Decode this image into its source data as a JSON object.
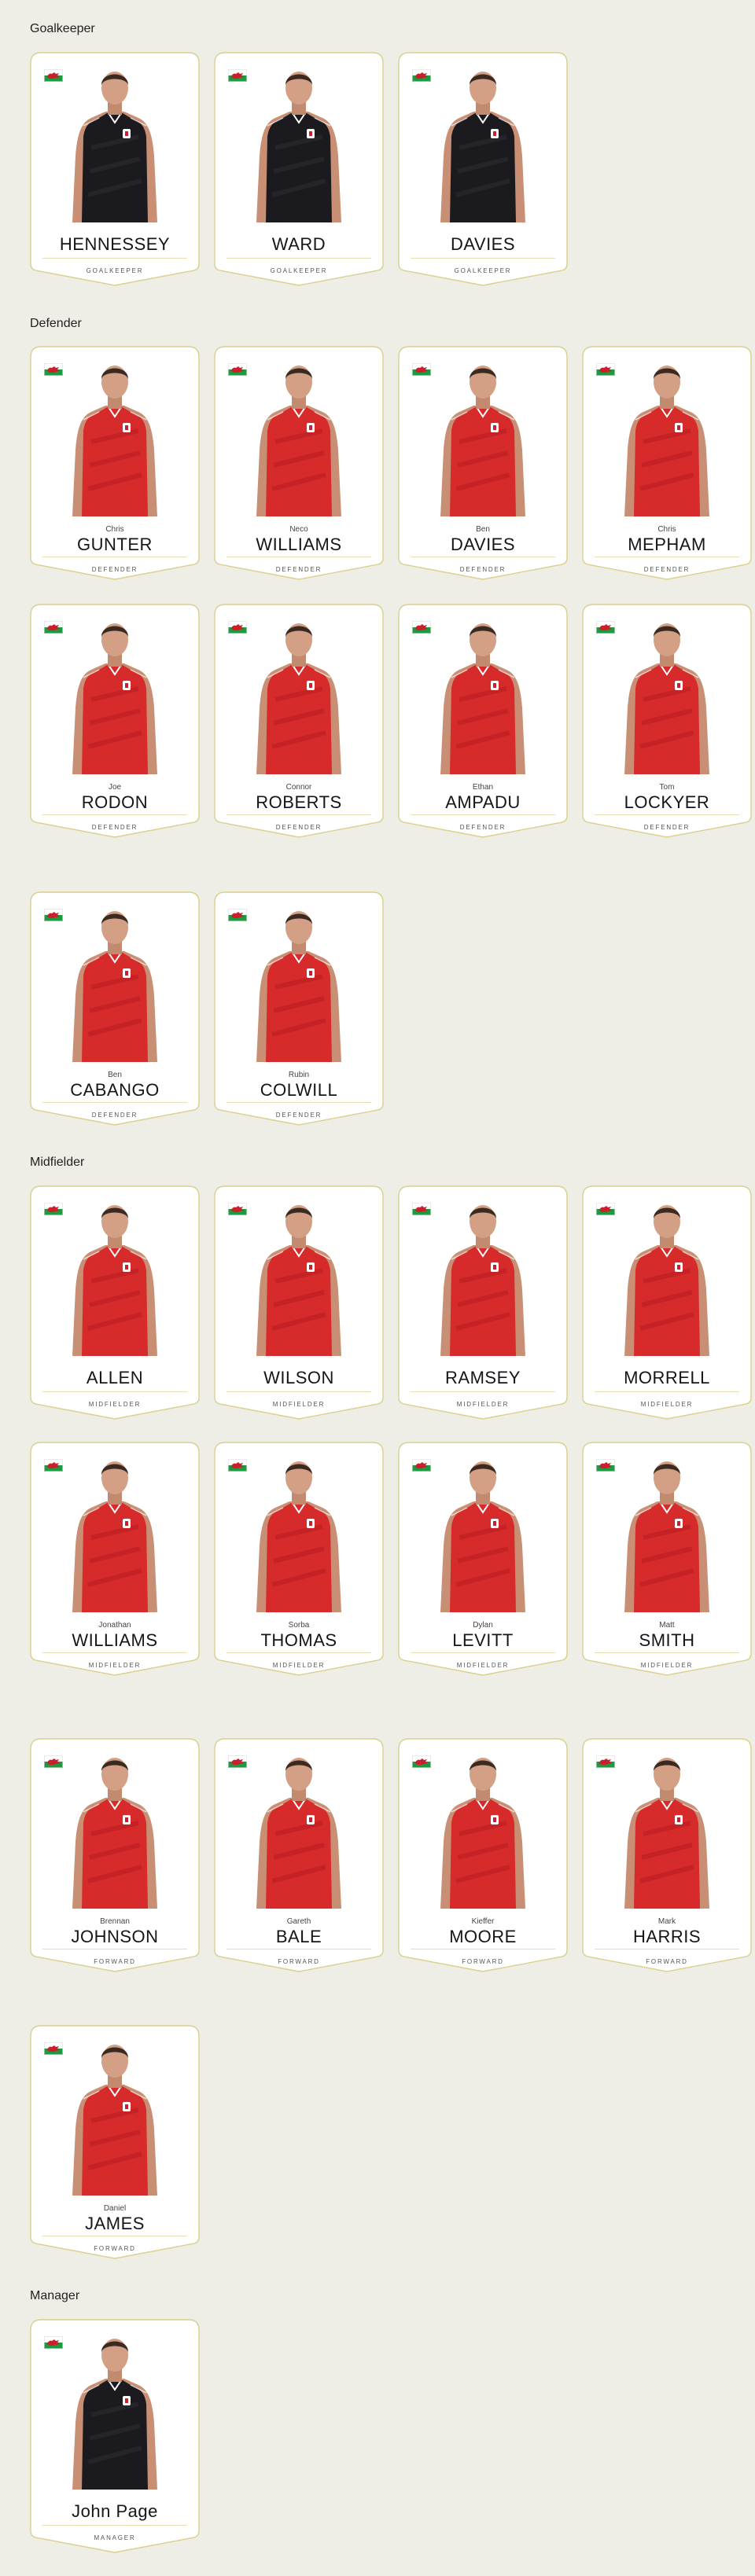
{
  "colors": {
    "page_bg": "#eeede6",
    "card_bg": "#ffffff",
    "card_border": "#dccf8c",
    "home_kit": "#d72a2a",
    "gk_kit": "#1b1b1f"
  },
  "sections": [
    {
      "title": "Goalkeeper",
      "players": [
        {
          "first": "",
          "last": "HENNESSEY",
          "position": "GOALKEEPER",
          "kit": "gk"
        },
        {
          "first": "",
          "last": "WARD",
          "position": "GOALKEEPER",
          "kit": "gk"
        },
        {
          "first": "",
          "last": "DAVIES",
          "position": "GOALKEEPER",
          "kit": "gk"
        }
      ]
    },
    {
      "title": "Defender",
      "players": [
        {
          "first": "Chris",
          "last": "GUNTER",
          "position": "DEFENDER",
          "kit": "home"
        },
        {
          "first": "Neco",
          "last": "WILLIAMS",
          "position": "DEFENDER",
          "kit": "home"
        },
        {
          "first": "Ben",
          "last": "DAVIES",
          "position": "DEFENDER",
          "kit": "home"
        },
        {
          "first": "Chris",
          "last": "MEPHAM",
          "position": "DEFENDER",
          "kit": "home"
        },
        {
          "first": "Joe",
          "last": "RODON",
          "position": "DEFENDER",
          "kit": "home"
        },
        {
          "first": "Connor",
          "last": "ROBERTS",
          "position": "DEFENDER",
          "kit": "home"
        },
        {
          "first": "Ethan",
          "last": "AMPADU",
          "position": "DEFENDER",
          "kit": "home"
        },
        {
          "first": "Tom",
          "last": "LOCKYER",
          "position": "DEFENDER",
          "kit": "home"
        },
        {
          "first": "Ben",
          "last": "CABANGO",
          "position": "DEFENDER",
          "kit": "home"
        },
        {
          "first": "Rubin",
          "last": "COLWILL",
          "position": "DEFENDER",
          "kit": "home"
        }
      ]
    },
    {
      "title": "Midfielder",
      "players": [
        {
          "first": "",
          "last": "ALLEN",
          "position": "MIDFIELDER",
          "kit": "home"
        },
        {
          "first": "",
          "last": "WILSON",
          "position": "MIDFIELDER",
          "kit": "home"
        },
        {
          "first": "",
          "last": "RAMSEY",
          "position": "MIDFIELDER",
          "kit": "home"
        },
        {
          "first": "",
          "last": "MORRELL",
          "position": "MIDFIELDER",
          "kit": "home"
        },
        {
          "first": "Jonathan",
          "last": "WILLIAMS",
          "position": "MIDFIELDER",
          "kit": "home"
        },
        {
          "first": "Sorba",
          "last": "THOMAS",
          "position": "MIDFIELDER",
          "kit": "home"
        },
        {
          "first": "Dylan",
          "last": "LEVITT",
          "position": "MIDFIELDER",
          "kit": "home"
        },
        {
          "first": "Matt",
          "last": "SMITH",
          "position": "MIDFIELDER",
          "kit": "home"
        },
        {
          "first": "Brennan",
          "last": "JOHNSON",
          "position": "FORWARD",
          "kit": "home"
        },
        {
          "first": "Gareth",
          "last": "BALE",
          "position": "FORWARD",
          "kit": "home"
        },
        {
          "first": "Kieffer",
          "last": "MOORE",
          "position": "FORWARD",
          "kit": "home"
        },
        {
          "first": "Mark",
          "last": "HARRIS",
          "position": "FORWARD",
          "kit": "home"
        },
        {
          "first": "Daniel",
          "last": "JAMES",
          "position": "FORWARD",
          "kit": "home"
        }
      ]
    },
    {
      "title": "Manager",
      "players": [
        {
          "first": "",
          "last": "John Page",
          "position": "MANAGER",
          "kit": "gk"
        }
      ]
    }
  ]
}
